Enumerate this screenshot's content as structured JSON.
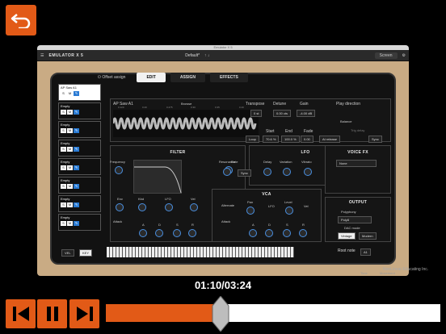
{
  "player": {
    "time": "01:10/03:24",
    "progress": 0.343
  },
  "app": {
    "window_title": "Emulator X 5",
    "logo": "EMULATOR X 5",
    "preset": "Default*",
    "screen_btn": "Screen"
  },
  "top": {
    "offset_assign": "Offset assign",
    "tabs": [
      "EDIT",
      "ASSIGN",
      "EFFECTS"
    ]
  },
  "samples": [
    {
      "name": "AP Saw A1"
    },
    {
      "name": "Empty"
    },
    {
      "name": "Empty"
    },
    {
      "name": "Empty"
    },
    {
      "name": "Empty"
    },
    {
      "name": "Empty"
    },
    {
      "name": "Empty"
    },
    {
      "name": "Empty"
    }
  ],
  "sample_btns": [
    "S",
    "M"
  ],
  "editor": {
    "sample_name": "AP Saw A1",
    "browse": "Browse",
    "transpose_label": "Transpose",
    "transpose_val": "0 st",
    "detune_label": "Detune",
    "detune_val": "0.00 cts",
    "gain_label": "Gain",
    "gain_val": "-4.00 dB",
    "play_dir": "Play direction",
    "balance": "Balance",
    "trig_delay": "Trig delay",
    "start": "Start",
    "end": "End",
    "fade": "Fade",
    "loop": "Loop",
    "start_val": "70.6 %",
    "end_val": "100.0 %",
    "fade_val": "0.00",
    "at_release": "At release",
    "sync": "Sync",
    "ticks": [
      "0.120",
      "0.20",
      "0.275",
      "0.30",
      "0.35",
      "0.40"
    ]
  },
  "filter": {
    "title": "FILTER",
    "frequency": "Frequency",
    "resonance": "Resonance",
    "env": "Env",
    "kbd": "Kbd",
    "lfo": "LFO",
    "vel": "Vel",
    "attack": "Attack",
    "a": "A",
    "d": "D",
    "s": "S",
    "r": "R"
  },
  "lfo": {
    "title": "LFO",
    "rate": "Rate",
    "delay": "Delay",
    "variation": "Variation",
    "vibrato": "Vibrato",
    "sync": "Sync"
  },
  "vca": {
    "title": "VCA",
    "alternate": "Alternate",
    "pan": "Pan",
    "lfo": "LFO",
    "level": "Level",
    "vel": "Vel",
    "attack": "Attack",
    "a": "A",
    "d": "D",
    "s": "S",
    "r": "R"
  },
  "voicefx": {
    "title": "VOICE FX",
    "value": "None"
  },
  "output": {
    "title": "OUTPUT",
    "polyphony": "Polyphony",
    "poly_val": "Poly8",
    "dac_mode": "DAC mode",
    "vintage": "Vintage",
    "modern": "Modern"
  },
  "bottom": {
    "vel": "VEL",
    "key": "KEY",
    "root_note": "Root note",
    "root_val": "A1",
    "time_lbl": "Time",
    "movement": "Movement"
  },
  "brand": "NonLinear Educating Inc."
}
